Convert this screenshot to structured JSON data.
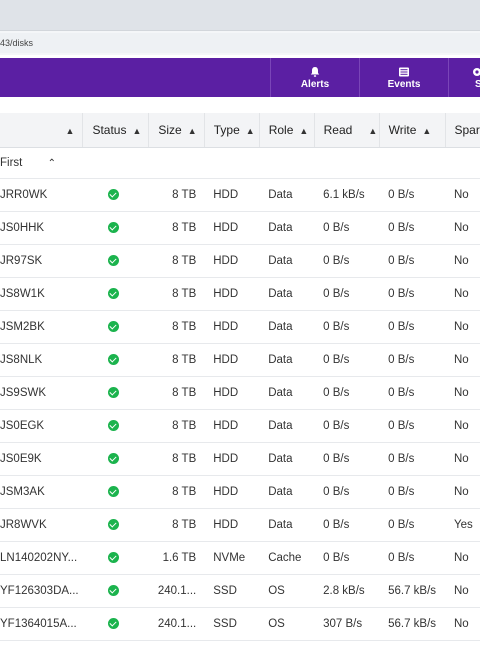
{
  "browser": {
    "url": "43/disks"
  },
  "navbar": {
    "items": [
      {
        "label": "Alerts",
        "icon": "bell-icon"
      },
      {
        "label": "Events",
        "icon": "list-icon"
      },
      {
        "label": "S",
        "icon": "settings-icon"
      }
    ],
    "color": "#5b1fa3"
  },
  "table": {
    "columns": [
      "",
      "Status",
      "Size",
      "Type",
      "Role",
      "Read",
      "Write",
      "Spare"
    ],
    "group_label": "First",
    "status_color": "#1bb34d",
    "rows": [
      {
        "name": "JRR0WK",
        "size": "8 TB",
        "type": "HDD",
        "role": "Data",
        "read": "6.1 kB/s",
        "write": "0 B/s",
        "spare": "No"
      },
      {
        "name": "JS0HHK",
        "size": "8 TB",
        "type": "HDD",
        "role": "Data",
        "read": "0 B/s",
        "write": "0 B/s",
        "spare": "No"
      },
      {
        "name": "JR97SK",
        "size": "8 TB",
        "type": "HDD",
        "role": "Data",
        "read": "0 B/s",
        "write": "0 B/s",
        "spare": "No"
      },
      {
        "name": "JS8W1K",
        "size": "8 TB",
        "type": "HDD",
        "role": "Data",
        "read": "0 B/s",
        "write": "0 B/s",
        "spare": "No"
      },
      {
        "name": "JSM2BK",
        "size": "8 TB",
        "type": "HDD",
        "role": "Data",
        "read": "0 B/s",
        "write": "0 B/s",
        "spare": "No"
      },
      {
        "name": "JS8NLK",
        "size": "8 TB",
        "type": "HDD",
        "role": "Data",
        "read": "0 B/s",
        "write": "0 B/s",
        "spare": "No"
      },
      {
        "name": "JS9SWK",
        "size": "8 TB",
        "type": "HDD",
        "role": "Data",
        "read": "0 B/s",
        "write": "0 B/s",
        "spare": "No"
      },
      {
        "name": "JS0EGK",
        "size": "8 TB",
        "type": "HDD",
        "role": "Data",
        "read": "0 B/s",
        "write": "0 B/s",
        "spare": "No"
      },
      {
        "name": "JS0E9K",
        "size": "8 TB",
        "type": "HDD",
        "role": "Data",
        "read": "0 B/s",
        "write": "0 B/s",
        "spare": "No"
      },
      {
        "name": "JSM3AK",
        "size": "8 TB",
        "type": "HDD",
        "role": "Data",
        "read": "0 B/s",
        "write": "0 B/s",
        "spare": "No"
      },
      {
        "name": "JR8WVK",
        "size": "8 TB",
        "type": "HDD",
        "role": "Data",
        "read": "0 B/s",
        "write": "0 B/s",
        "spare": "Yes"
      },
      {
        "name": "LN140202NY...",
        "size": "1.6 TB",
        "type": "NVMe",
        "role": "Cache",
        "read": "0 B/s",
        "write": "0 B/s",
        "spare": "No"
      },
      {
        "name": "YF126303DA...",
        "size": "240.1...",
        "type": "SSD",
        "role": "OS",
        "read": "2.8 kB/s",
        "write": "56.7 kB/s",
        "spare": "No"
      },
      {
        "name": "YF1364015A...",
        "size": "240.1...",
        "type": "SSD",
        "role": "OS",
        "read": "307 B/s",
        "write": "56.7 kB/s",
        "spare": "No"
      }
    ]
  }
}
